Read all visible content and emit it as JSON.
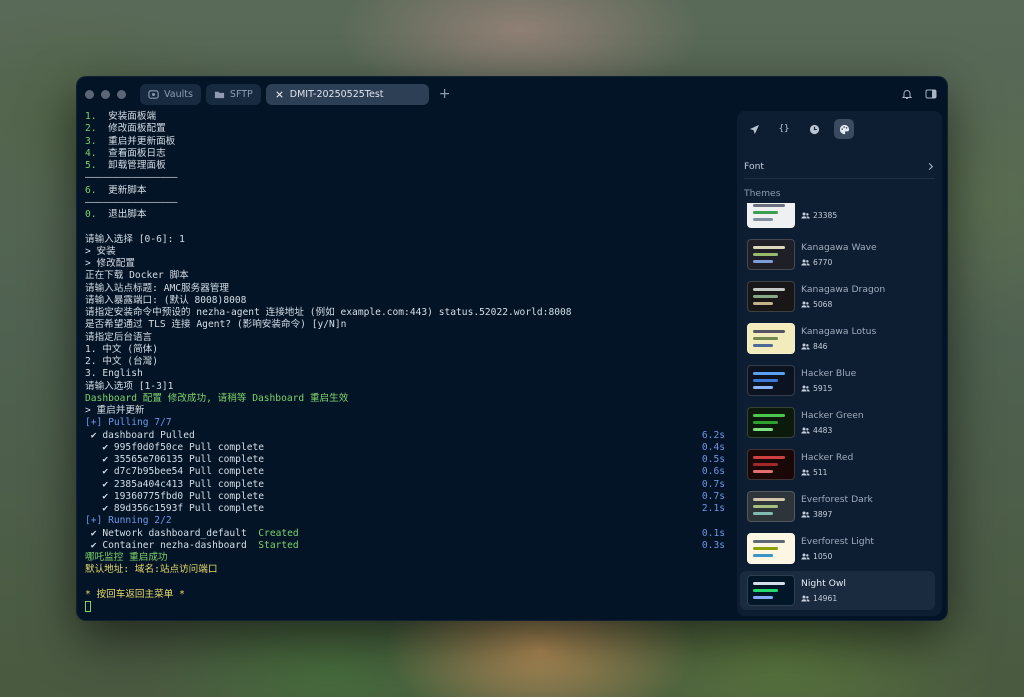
{
  "titlebar": {
    "tabs": [
      {
        "label": "Vaults",
        "icon": "vault-icon"
      },
      {
        "label": "SFTP",
        "icon": "folder-icon"
      },
      {
        "label": "DMIT-20250525Test",
        "icon": "close-icon",
        "active": true
      }
    ],
    "new_tab": "+"
  },
  "terminal": {
    "lines": [
      {
        "text": "1.  安装面板端",
        "color": "mixed_num"
      },
      {
        "text": "2.  修改面板配置",
        "color": "mixed_num"
      },
      {
        "text": "3.  重启并更新面板",
        "color": "mixed_num"
      },
      {
        "text": "4.  查看面板日志",
        "color": "mixed_num"
      },
      {
        "text": "5.  卸载管理面板",
        "color": "mixed_num"
      },
      {
        "text": "————————————————",
        "color": ""
      },
      {
        "text": "6.  更新脚本",
        "color": "mixed_num"
      },
      {
        "text": "————————————————",
        "color": ""
      },
      {
        "text": "0.  退出脚本",
        "color": "mixed_num"
      },
      {
        "text": "",
        "color": ""
      },
      {
        "text": "请输入选择 [0-6]: 1",
        "color": ""
      },
      {
        "text": "> 安装",
        "color": ""
      },
      {
        "text": "> 修改配置",
        "color": ""
      },
      {
        "text": "正在下载 Docker 脚本",
        "color": ""
      },
      {
        "text": "请输入站点标题: AMC服务器管理",
        "color": ""
      },
      {
        "text": "请输入暴露端口: (默认 8008)8008",
        "color": ""
      },
      {
        "text": "请指定安装命令中预设的 nezha-agent 连接地址 (例如 example.com:443) status.52022.world:8008",
        "color": ""
      },
      {
        "text": "是否希望通过 TLS 连接 Agent? (影响安装命令) [y/N]n",
        "color": ""
      },
      {
        "text": "请指定后台语言",
        "color": ""
      },
      {
        "text": "1. 中文 (简体)",
        "color": ""
      },
      {
        "text": "2. 中文 (台灣)",
        "color": ""
      },
      {
        "text": "3. English",
        "color": ""
      },
      {
        "text": "请输入选项 [1-3]1",
        "color": ""
      },
      {
        "text": "Dashboard 配置 修改成功, 请稍等 Dashboard 重启生效",
        "color": "g"
      },
      {
        "text": "> 重启并更新",
        "color": ""
      },
      {
        "text": "[+] Pulling 7/7",
        "color": "b"
      },
      {
        "text": " ✔ dashboard Pulled",
        "color": "",
        "time": "6.2s"
      },
      {
        "text": "   ✔ 995f0d0f50ce Pull complete",
        "color": "",
        "time": "0.4s"
      },
      {
        "text": "   ✔ 35565e706135 Pull complete",
        "color": "",
        "time": "0.5s"
      },
      {
        "text": "   ✔ d7c7b95bee54 Pull complete",
        "color": "",
        "time": "0.6s"
      },
      {
        "text": "   ✔ 2385a404c413 Pull complete",
        "color": "",
        "time": "0.7s"
      },
      {
        "text": "   ✔ 19360775fbd0 Pull complete",
        "color": "",
        "time": "0.7s"
      },
      {
        "text": "   ✔ 89d356c1593f Pull complete",
        "color": "",
        "time": "2.1s"
      },
      {
        "text": "[+] Running 2/2",
        "color": "b"
      },
      {
        "text": " ✔ Network dashboard_default  ",
        "color": "",
        "status": "Created",
        "time": "0.1s"
      },
      {
        "text": " ✔ Container nezha-dashboard  ",
        "color": "",
        "status": "Started",
        "time": "0.3s"
      },
      {
        "text": "哪吒监控 重启成功",
        "color": "g"
      },
      {
        "text": "默认地址: 域名:站点访问端口",
        "color": "y"
      },
      {
        "text": "",
        "color": ""
      },
      {
        "text": "* 按回车返回主菜单 *",
        "color": "y"
      }
    ]
  },
  "panel": {
    "icons": [
      "send-icon",
      "braces-icon",
      "clock-icon",
      "palette-icon"
    ],
    "braces_label": "{}",
    "font_label": "Font",
    "themes_label": "Themes",
    "themes": [
      {
        "name": "",
        "count": "23385",
        "bg": "#eef0f2",
        "c1": "#6a7080",
        "c2": "#3aa050",
        "c3": "#8090a0"
      },
      {
        "name": "Kanagawa Wave",
        "count": "6770",
        "bg": "#1f1f28",
        "c1": "#dcd7ba",
        "c2": "#98bb6c",
        "c3": "#7e9cd8"
      },
      {
        "name": "Kanagawa Dragon",
        "count": "5068",
        "bg": "#181616",
        "c1": "#c5c9c5",
        "c2": "#87a987",
        "c3": "#c4b28a"
      },
      {
        "name": "Kanagawa Lotus",
        "count": "846",
        "bg": "#f2ecbc",
        "c1": "#545464",
        "c2": "#6f894e",
        "c3": "#4d699b"
      },
      {
        "name": "Hacker Blue",
        "count": "5915",
        "bg": "#0b1220",
        "c1": "#5aa0f0",
        "c2": "#3c78d8",
        "c3": "#8ab4f8"
      },
      {
        "name": "Hacker Green",
        "count": "4483",
        "bg": "#0c1a0c",
        "c1": "#4cc84c",
        "c2": "#2ea02e",
        "c3": "#7ee07e"
      },
      {
        "name": "Hacker Red",
        "count": "511",
        "bg": "#1a0808",
        "c1": "#d04040",
        "c2": "#a02828",
        "c3": "#e07070"
      },
      {
        "name": "Everforest Dark",
        "count": "3897",
        "bg": "#2d353b",
        "c1": "#d3c6aa",
        "c2": "#a7c080",
        "c3": "#7fbbb3"
      },
      {
        "name": "Everforest Light",
        "count": "1050",
        "bg": "#fdf6e3",
        "c1": "#5c6a72",
        "c2": "#8da101",
        "c3": "#3a94c5"
      },
      {
        "name": "Night Owl",
        "count": "14961",
        "bg": "#011627",
        "c1": "#d6deeb",
        "c2": "#22da6e",
        "c3": "#82aaff",
        "selected": true
      }
    ]
  },
  "colors": {
    "window_bg": "#031426",
    "panel_bg": "#0d1e32",
    "green": "#7bd36b",
    "blue": "#6f96e8",
    "yellow": "#e8d86a"
  }
}
